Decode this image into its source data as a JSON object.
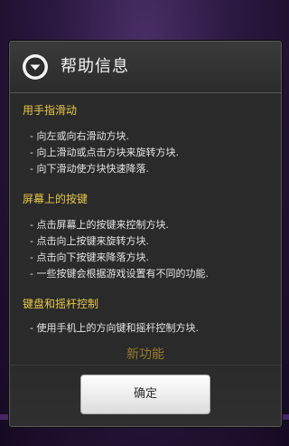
{
  "dialog": {
    "title": "帮助信息",
    "sections": [
      {
        "title": "用手指滑动",
        "items": [
          "- 向左或向右滑动方块.",
          "- 向上滑动或点击方块来旋转方块.",
          "- 向下滑动使方块快速降落."
        ]
      },
      {
        "title": "屏幕上的按键",
        "items": [
          "- 点击屏幕上的按键来控制方块.",
          "- 点击向上按键来旋转方块.",
          "- 点击向下按键来降落方块.",
          "- 一些按键会根据游戏设置有不同的功能."
        ]
      },
      {
        "title": "键盘和摇杆控制",
        "items": [
          "- 使用手机上的方向键和摇杆控制方块."
        ]
      }
    ],
    "more_text": "新功能",
    "ok_label": "确定"
  }
}
